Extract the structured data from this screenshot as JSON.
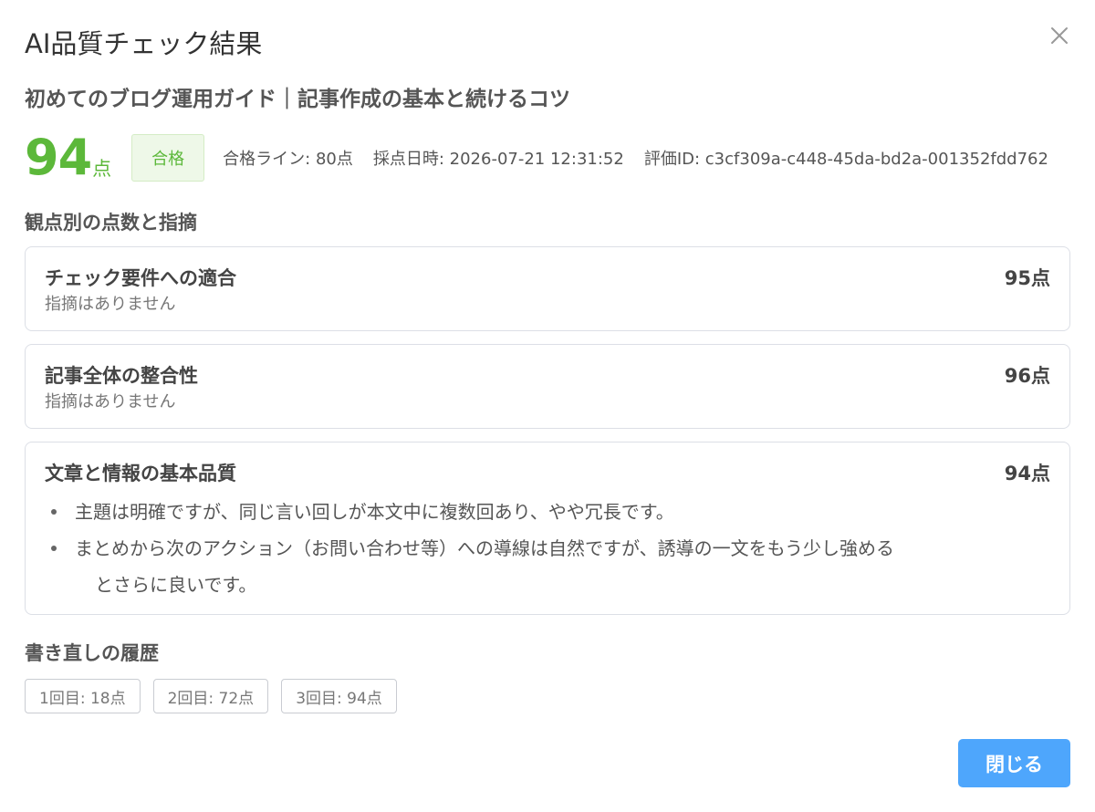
{
  "dialog": {
    "title": "AI品質チェック結果",
    "close_icon": "close-icon"
  },
  "article": {
    "title": "初めてのブログ運用ガイド｜記事作成の基本と続けるコツ"
  },
  "result": {
    "score": "94",
    "score_unit": "点",
    "status": "合格",
    "pass_line": "合格ライン: 80点",
    "graded_at": "採点日時: 2026-07-21 12:31:52",
    "evaluation_id": "評価ID: c3cf309a-c448-45da-bd2a-001352fdd762",
    "colors": {
      "pass": "#5cb83a",
      "primary": "#4ea6fc"
    }
  },
  "criteria": {
    "heading": "観点別の点数と指摘",
    "items": [
      {
        "name": "チェック要件への適合",
        "score": "95点",
        "note": "指摘はありません"
      },
      {
        "name": "記事全体の整合性",
        "score": "96点",
        "note": "指摘はありません"
      },
      {
        "name": "文章と情報の基本品質",
        "score": "94点",
        "issues": [
          "主題は明確ですが、同じ言い回しが本文中に複数回あり、やや冗長です。",
          "まとめから次のアクション（お問い合わせ等）への導線は自然ですが、誘導の一文をもう少し強める",
          "とさらに良いです。"
        ]
      }
    ]
  },
  "history": {
    "heading": "書き直しの履歴",
    "items": [
      "1回目: 18点",
      "2回目: 72点",
      "3回目: 94点"
    ]
  },
  "footer": {
    "close_label": "閉じる"
  }
}
